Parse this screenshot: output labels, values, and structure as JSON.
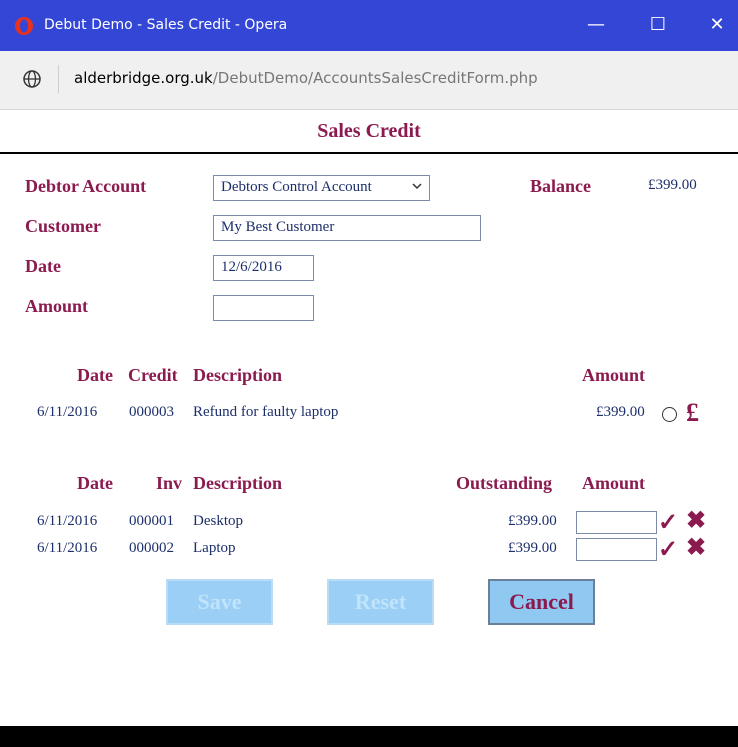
{
  "window": {
    "title": "Debut Demo - Sales Credit - Opera",
    "minimize": "—",
    "maximize": "☐",
    "close": "✕"
  },
  "address": {
    "host": "alderbridge.org.uk",
    "path": "/DebutDemo/AccountsSalesCreditForm.php"
  },
  "page": {
    "title": "Sales Credit"
  },
  "form": {
    "debtor_label": "Debtor Account",
    "debtor_value": "Debtors Control Account",
    "balance_label": "Balance",
    "balance_value": "£399.00",
    "customer_label": "Customer",
    "customer_value": "My Best Customer",
    "date_label": "Date",
    "date_value": "12/6/2016",
    "amount_label": "Amount",
    "amount_value": ""
  },
  "credits": {
    "headers": {
      "date": "Date",
      "credit": "Credit",
      "description": "Description",
      "amount": "Amount"
    },
    "rows": [
      {
        "date": "6/11/2016",
        "number": "000003",
        "description": "Refund for faulty laptop",
        "amount": "£399.00",
        "action": "£"
      }
    ]
  },
  "invoices": {
    "headers": {
      "date": "Date",
      "inv": "Inv",
      "description": "Description",
      "outstanding": "Outstanding",
      "amount": "Amount"
    },
    "rows": [
      {
        "date": "6/11/2016",
        "number": "000001",
        "description": "Desktop",
        "outstanding": "£399.00",
        "amount": "",
        "accept": "✓",
        "reject": "✖"
      },
      {
        "date": "6/11/2016",
        "number": "000002",
        "description": "Laptop",
        "outstanding": "£399.00",
        "amount": "",
        "accept": "✓",
        "reject": "✖"
      }
    ]
  },
  "buttons": {
    "save": "Save",
    "reset": "Reset",
    "cancel": "Cancel"
  },
  "colors": {
    "titlebar": "#3346d6",
    "label": "#8b1a4f",
    "text": "#1c2f6b",
    "button": "#8fc8f1"
  }
}
